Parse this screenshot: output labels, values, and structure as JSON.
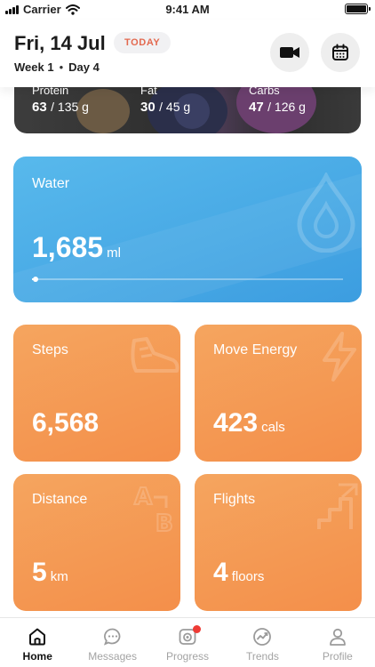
{
  "status_bar": {
    "carrier": "Carrier",
    "time": "9:41 AM",
    "battery_level": 1.0
  },
  "header": {
    "date": "Fri, 14 Jul",
    "badge": "TODAY",
    "week": "Week 1",
    "day": "Day 4",
    "icons": [
      "video-camera-icon",
      "calendar-icon"
    ]
  },
  "macros": {
    "protein": {
      "label": "Protein",
      "value": "63",
      "total": "/ 135 g"
    },
    "fat": {
      "label": "Fat",
      "value": "30",
      "total": "/ 45 g"
    },
    "carbs": {
      "label": "Carbs",
      "value": "47",
      "total": "/ 126 g"
    }
  },
  "water": {
    "title": "Water",
    "value": "1,685",
    "unit": "ml",
    "progress": 0.01,
    "icon": "water-drop-icon",
    "color": "#4aa8e6"
  },
  "steps": {
    "title": "Steps",
    "value": "6,568",
    "unit": "",
    "icon": "shoe-icon"
  },
  "move_energy": {
    "title": "Move Energy",
    "value": "423",
    "unit": "cals",
    "icon": "lightning-icon"
  },
  "distance": {
    "title": "Distance",
    "value": "5",
    "unit": "km",
    "icon": "a-to-b-icon"
  },
  "flights": {
    "title": "Flights",
    "value": "4",
    "unit": "floors",
    "icon": "stairs-icon"
  },
  "accent_orange": "#f59a52",
  "tabs": [
    {
      "label": "Home",
      "icon": "home-icon",
      "active": true
    },
    {
      "label": "Messages",
      "icon": "chat-icon",
      "active": false
    },
    {
      "label": "Progress",
      "icon": "camera-icon",
      "active": false,
      "has_notification": true
    },
    {
      "label": "Trends",
      "icon": "trend-icon",
      "active": false
    },
    {
      "label": "Profile",
      "icon": "person-icon",
      "active": false
    }
  ]
}
